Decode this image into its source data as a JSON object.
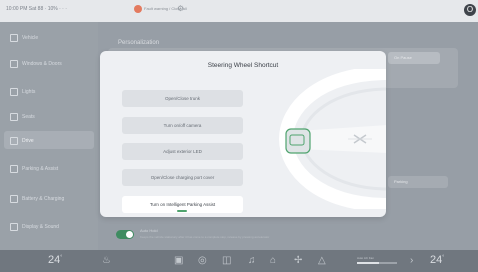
{
  "status_bar": {
    "left_text": "10:00 PM Sat 88 · 10% · · ·",
    "badge_text": "Fault warning / Close all",
    "avatar_initial": "O"
  },
  "sidebar": {
    "items": [
      {
        "label": "Vehicle"
      },
      {
        "label": "Windows & Doors"
      },
      {
        "label": "Lights"
      },
      {
        "label": "Seats"
      },
      {
        "label": "Drive"
      },
      {
        "label": "Parking & Assist"
      },
      {
        "label": "Battery & Charging"
      },
      {
        "label": "Display & Sound"
      }
    ],
    "active_index": 4
  },
  "content": {
    "section_title": "Personalization",
    "chip_label": "On Pause",
    "chip2_label": "Parking",
    "toggle_label": "Auto Hold",
    "toggle_desc": "Keeps the vehicle stationary after it has come to a complete stop, release by pressing accelerator"
  },
  "modal": {
    "title": "Steering Wheel Shortcut",
    "options": [
      {
        "label": "Open/Close trunk"
      },
      {
        "label": "Turn on/off camera"
      },
      {
        "label": "Adjust exterior LED"
      },
      {
        "label": "Open/Close charging port cover"
      },
      {
        "label": "Turn on Intelligent Parking Assist"
      }
    ],
    "selected_index": 4,
    "accent_color": "#4fa36e"
  },
  "dock": {
    "left_temp": "24",
    "right_temp": "24",
    "temp_unit": "°",
    "fan_label": "Auto AC Fan",
    "fan_level": 0.55
  }
}
